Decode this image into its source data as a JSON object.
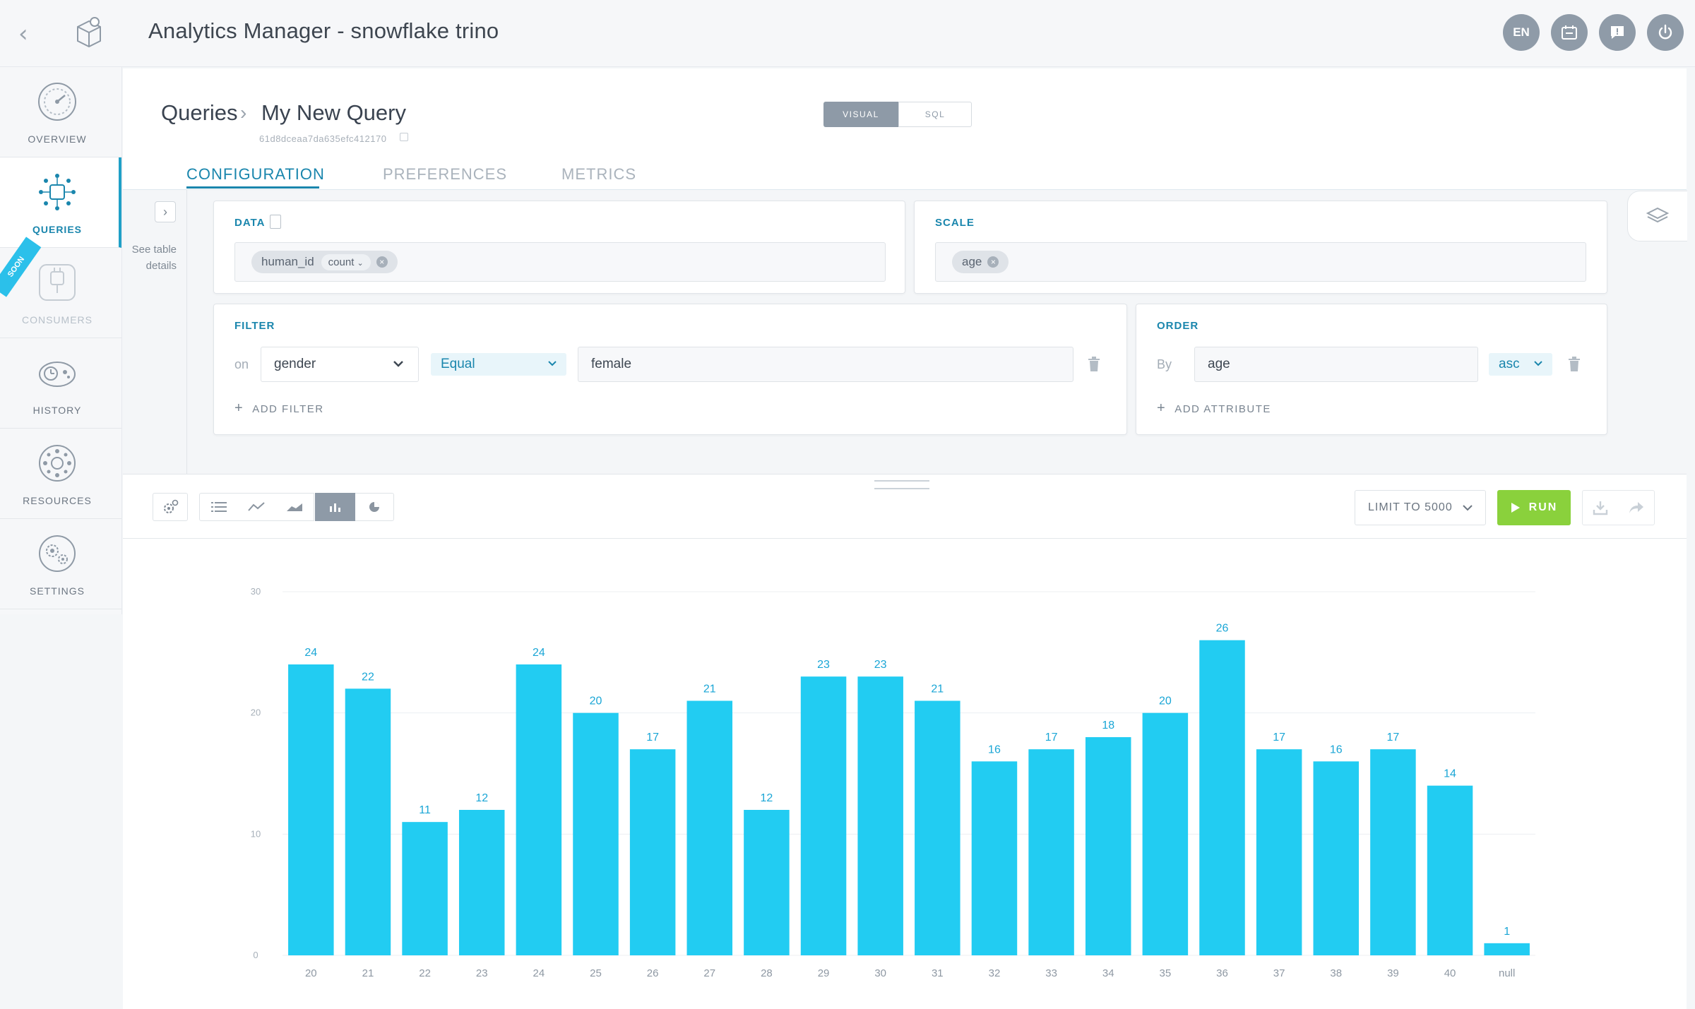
{
  "app": {
    "title": "Analytics Manager - snowflake trino",
    "back_glyph": "‹"
  },
  "topbar": {
    "lang_label": "EN"
  },
  "nav": {
    "items": [
      {
        "label": "OVERVIEW",
        "icon": "gauge-icon"
      },
      {
        "label": "QUERIES",
        "icon": "network-icon"
      },
      {
        "label": "CONSUMERS",
        "icon": "plug-icon"
      },
      {
        "label": "HISTORY",
        "icon": "clock-icon"
      },
      {
        "label": "RESOURCES",
        "icon": "hub-icon"
      },
      {
        "label": "SETTINGS",
        "icon": "gears-icon"
      }
    ],
    "ribbon": "SOON"
  },
  "breadcrumb": {
    "root": "Queries",
    "current": "My New Query",
    "query_id": "61d8dceaa7da635efc412170"
  },
  "mode_toggle": {
    "visual": "VISUAL",
    "sql": "SQL"
  },
  "tabs": [
    {
      "label": "CONFIGURATION",
      "active": true
    },
    {
      "label": "PREFERENCES",
      "active": false
    },
    {
      "label": "METRICS",
      "active": false
    }
  ],
  "side_panel": {
    "line1": "See table",
    "line2": "details"
  },
  "data_card": {
    "title": "DATA",
    "chip_field": "human_id",
    "chip_agg": "count"
  },
  "scale_card": {
    "title": "SCALE",
    "chip": "age"
  },
  "filter_card": {
    "title": "FILTER",
    "prefix": "on",
    "attribute": "gender",
    "operator": "Equal",
    "value": "female",
    "add_label": "ADD FILTER"
  },
  "order_card": {
    "title": "ORDER",
    "prefix": "By",
    "attribute": "age",
    "direction": "asc",
    "add_label": "ADD ATTRIBUTE"
  },
  "toolbar": {
    "limit_label": "LIMIT TO 5000",
    "run_label": "RUN",
    "active_view": "bar"
  },
  "colors": {
    "accent": "#1a86ad",
    "bar": "#22ccf2",
    "run": "#8ad13c",
    "label": "#1aa6d6"
  },
  "chart_data": {
    "type": "bar",
    "categories": [
      "20",
      "21",
      "22",
      "23",
      "24",
      "25",
      "26",
      "27",
      "28",
      "29",
      "30",
      "31",
      "32",
      "33",
      "34",
      "35",
      "36",
      "37",
      "38",
      "39",
      "40",
      "null"
    ],
    "values": [
      24,
      22,
      11,
      12,
      24,
      20,
      17,
      21,
      12,
      23,
      23,
      21,
      16,
      17,
      18,
      20,
      26,
      17,
      16,
      17,
      14,
      1
    ],
    "ylim": [
      0,
      30
    ],
    "yticks": [
      0,
      10,
      20,
      30
    ],
    "data_labels": true,
    "grid": true
  }
}
